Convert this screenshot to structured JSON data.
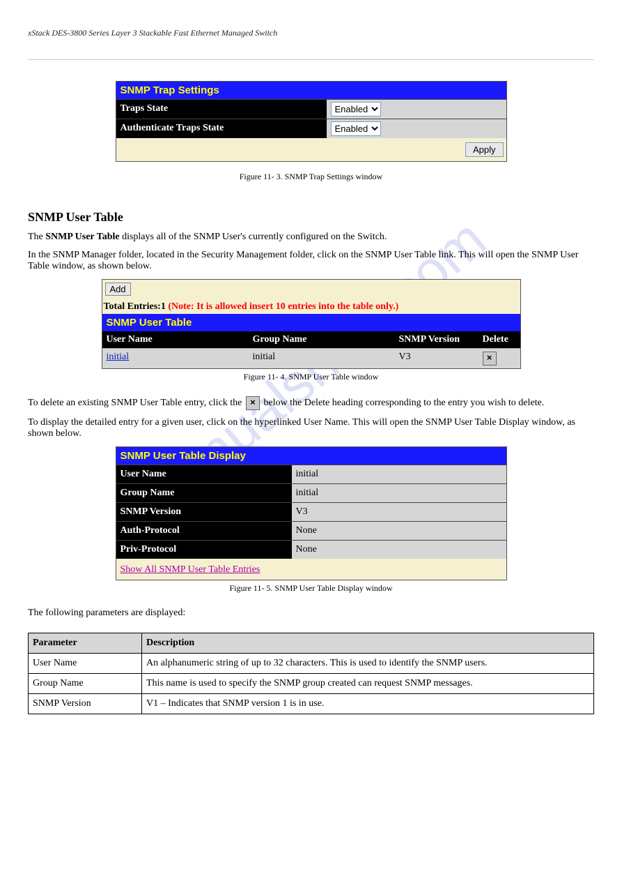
{
  "page_header": {
    "left": "xStack DES-3800 Series Layer 3 Stackable Fast Ethernet Managed Switch",
    "right": ""
  },
  "trap": {
    "title": "SNMP Trap Settings",
    "rows": [
      {
        "label": "Traps State",
        "value": "Enabled"
      },
      {
        "label": "Authenticate Traps State",
        "value": "Enabled"
      }
    ],
    "apply": "Apply",
    "caption": "Figure 11- 3. SNMP Trap Settings window"
  },
  "user_section": {
    "heading": "SNMP User Table",
    "intro_1": "The ",
    "intro_bold": "SNMP User Table",
    "intro_2": " displays all of the SNMP User's currently configured on the Switch.",
    "nav": "In the SNMP Manager folder, located in the Security Management folder, click on the SNMP User Table link. This will open the SNMP User Table window, as shown below.",
    "add_label": "Add",
    "total_prefix": "Total Entries:",
    "total_count": "1",
    "note": "(Note: It is allowed insert 10 entries into the table only.)",
    "table_title": "SNMP User Table",
    "cols": {
      "user": "User Name",
      "group": "Group Name",
      "ver": "SNMP Version",
      "del": "Delete"
    },
    "rows": [
      {
        "user": "initial",
        "group": "initial",
        "ver": "V3"
      }
    ],
    "caption": "Figure 11- 4. SNMP User Table window",
    "delete_instr_1": "To delete an existing SNMP User Table entry, click the ",
    "delete_instr_2": " below the Delete heading corresponding to the entry you wish to delete.",
    "display_instr": "To display the detailed entry for a given user, click on the hyperlinked User Name. This will open the SNMP User Table Display window, as shown below."
  },
  "display": {
    "title": "SNMP User Table Display",
    "rows": [
      {
        "label": "User Name",
        "value": "initial"
      },
      {
        "label": "Group Name",
        "value": "initial"
      },
      {
        "label": "SNMP Version",
        "value": "V3"
      },
      {
        "label": "Auth-Protocol",
        "value": "None"
      },
      {
        "label": "Priv-Protocol",
        "value": "None"
      }
    ],
    "show_link": "Show All SNMP User Table Entries",
    "caption": "Figure 11- 5. SNMP User Table Display window",
    "after": "The following parameters are displayed:"
  },
  "params": {
    "header": {
      "p": "Parameter",
      "d": "Description"
    },
    "rows": [
      {
        "p": "User Name",
        "d": "An alphanumeric string of up to 32 characters. This is used to identify the SNMP users."
      },
      {
        "p": "Group Name",
        "d": "This name is used to specify the SNMP group created can request SNMP messages."
      },
      {
        "p": "SNMP Version",
        "d": "V1 – Indicates that SNMP version 1 is in use."
      }
    ]
  },
  "watermark": "manualshive.com"
}
